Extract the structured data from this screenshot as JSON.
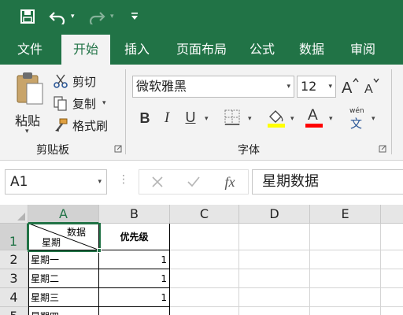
{
  "quick_access": {
    "save_icon": "save-icon",
    "undo_icon": "undo-icon",
    "redo_icon": "redo-icon",
    "customize_icon": "customize-toolbar-icon"
  },
  "tabs": [
    "文件",
    "开始",
    "插入",
    "页面布局",
    "公式",
    "数据",
    "审阅"
  ],
  "active_tab": "开始",
  "ribbon": {
    "clipboard": {
      "paste_label": "粘贴",
      "cut_label": "剪切",
      "copy_label": "复制",
      "format_painter_label": "格式刷",
      "group_label": "剪贴板"
    },
    "font": {
      "font_name": "微软雅黑",
      "font_size": "12",
      "group_label": "字体",
      "phonetic_char": "wén",
      "phonetic_base": "文",
      "bold": "B",
      "italic": "I",
      "underline": "U",
      "font_color_letter": "A",
      "highlight_color": "#ffff00",
      "font_color": "#ff0000"
    }
  },
  "formula_bar": {
    "name_box": "A1",
    "dots": "⋮",
    "fx": "fx",
    "value": "星期数据"
  },
  "grid": {
    "columns": [
      "A",
      "B",
      "C",
      "D",
      "E"
    ],
    "rows": [
      "1",
      "2",
      "3",
      "4",
      "5"
    ],
    "selected_column": "A",
    "selected_row": "1",
    "header_cell": {
      "top_right": "数据",
      "bottom_left": "星期",
      "b1": "优先级"
    },
    "data_rows": [
      {
        "a": "星期一",
        "b": "1"
      },
      {
        "a": "星期二",
        "b": "1"
      },
      {
        "a": "星期三",
        "b": "1"
      },
      {
        "a": "星期四",
        "b": ""
      }
    ]
  },
  "colors": {
    "accent": "#217346",
    "ribbon_bg": "#f3f3f3"
  }
}
